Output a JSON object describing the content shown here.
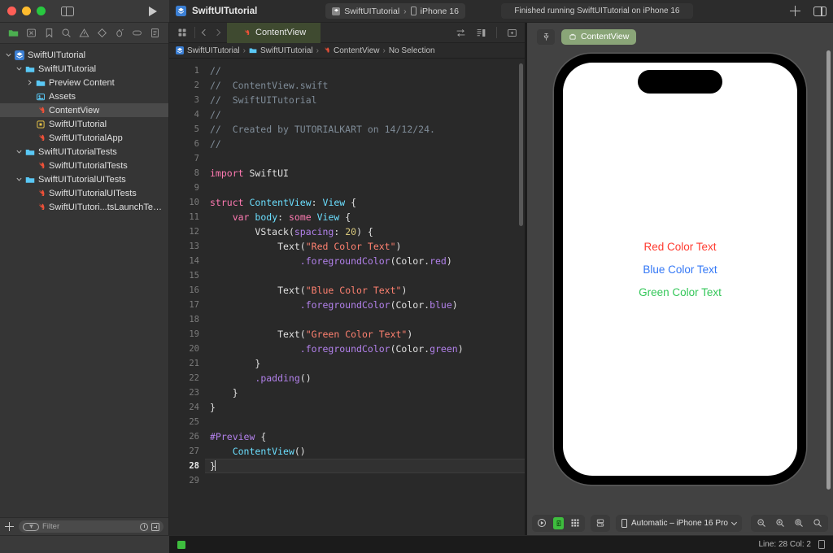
{
  "toolbar": {
    "project_title": "SwiftUITutorial",
    "scheme_name": "SwiftUITutorial",
    "scheme_separator": "›",
    "destination": "iPhone 16",
    "status_message": "Finished running SwiftUITutorial on iPhone 16",
    "add_label": "+",
    "traffic_lights": [
      "close",
      "minimize",
      "zoom"
    ]
  },
  "navigator": {
    "tabs": [
      "folder-icon",
      "x-square-icon",
      "bookmark-icon",
      "search-icon",
      "warning-icon",
      "diamond-icon",
      "debug-icon",
      "capsule-icon",
      "report-icon"
    ],
    "filter": {
      "placeholder": "Filter"
    },
    "tree": [
      {
        "label": "SwiftUITutorial",
        "indent": 0,
        "twisty": "down",
        "icon": "xcode-project-icon",
        "selected": false
      },
      {
        "label": "SwiftUITutorial",
        "indent": 1,
        "twisty": "down",
        "icon": "folder-icon",
        "selected": false
      },
      {
        "label": "Preview Content",
        "indent": 2,
        "twisty": "right",
        "icon": "folder-icon",
        "selected": false
      },
      {
        "label": "Assets",
        "indent": 2,
        "twisty": "none",
        "icon": "assets-icon",
        "selected": false
      },
      {
        "label": "ContentView",
        "indent": 2,
        "twisty": "none",
        "icon": "swift-file-icon",
        "selected": true
      },
      {
        "label": "SwiftUITutorial",
        "indent": 2,
        "twisty": "none",
        "icon": "plist-icon",
        "selected": false
      },
      {
        "label": "SwiftUITutorialApp",
        "indent": 2,
        "twisty": "none",
        "icon": "swift-file-icon",
        "selected": false
      },
      {
        "label": "SwiftUITutorialTests",
        "indent": 1,
        "twisty": "down",
        "icon": "folder-icon",
        "selected": false
      },
      {
        "label": "SwiftUITutorialTests",
        "indent": 2,
        "twisty": "none",
        "icon": "swift-file-icon",
        "selected": false
      },
      {
        "label": "SwiftUITutorialUITests",
        "indent": 1,
        "twisty": "down",
        "icon": "folder-icon",
        "selected": false
      },
      {
        "label": "SwiftUITutorialUITests",
        "indent": 2,
        "twisty": "none",
        "icon": "swift-file-icon",
        "selected": false
      },
      {
        "label": "SwiftUITutori...tsLaunchTests",
        "indent": 2,
        "twisty": "none",
        "icon": "swift-file-icon",
        "selected": false
      }
    ]
  },
  "editor": {
    "tab_label": "ContentView",
    "breadcrumb": [
      {
        "label": "SwiftUITutorial",
        "icon": "xcode-project-icon"
      },
      {
        "label": "SwiftUITutorial",
        "icon": "folder-icon"
      },
      {
        "label": "ContentView",
        "icon": "swift-file-icon"
      },
      {
        "label": "No Selection",
        "icon": "none"
      }
    ],
    "breadcrumb_separator": "›",
    "current_line": 28,
    "lines": [
      {
        "n": 1,
        "tokens": [
          {
            "t": "//",
            "c": "cm"
          }
        ]
      },
      {
        "n": 2,
        "tokens": [
          {
            "t": "//  ContentView.swift",
            "c": "cm"
          }
        ]
      },
      {
        "n": 3,
        "tokens": [
          {
            "t": "//  SwiftUITutorial",
            "c": "cm"
          }
        ]
      },
      {
        "n": 4,
        "tokens": [
          {
            "t": "//",
            "c": "cm"
          }
        ]
      },
      {
        "n": 5,
        "tokens": [
          {
            "t": "//  Created by TUTORIALKART on 14/12/24.",
            "c": "cm"
          }
        ]
      },
      {
        "n": 6,
        "tokens": [
          {
            "t": "//",
            "c": "cm"
          }
        ]
      },
      {
        "n": 7,
        "tokens": []
      },
      {
        "n": 8,
        "tokens": [
          {
            "t": "import",
            "c": "kw"
          },
          {
            "t": " SwiftUI",
            "c": ""
          }
        ]
      },
      {
        "n": 9,
        "tokens": []
      },
      {
        "n": 10,
        "tokens": [
          {
            "t": "struct",
            "c": "kw"
          },
          {
            "t": " ",
            "c": ""
          },
          {
            "t": "ContentView",
            "c": "ty"
          },
          {
            "t": ": ",
            "c": ""
          },
          {
            "t": "View",
            "c": "ty"
          },
          {
            "t": " {",
            "c": ""
          }
        ]
      },
      {
        "n": 11,
        "tokens": [
          {
            "t": "    ",
            "c": ""
          },
          {
            "t": "var",
            "c": "kw"
          },
          {
            "t": " ",
            "c": ""
          },
          {
            "t": "body",
            "c": "ty"
          },
          {
            "t": ": ",
            "c": ""
          },
          {
            "t": "some",
            "c": "kw"
          },
          {
            "t": " ",
            "c": ""
          },
          {
            "t": "View",
            "c": "ty"
          },
          {
            "t": " {",
            "c": ""
          }
        ]
      },
      {
        "n": 12,
        "tokens": [
          {
            "t": "        ",
            "c": ""
          },
          {
            "t": "VStack",
            "c": ""
          },
          {
            "t": "(",
            "c": ""
          },
          {
            "t": "spacing",
            "c": "fn"
          },
          {
            "t": ": ",
            "c": ""
          },
          {
            "t": "20",
            "c": "num"
          },
          {
            "t": ") {",
            "c": ""
          }
        ]
      },
      {
        "n": 13,
        "tokens": [
          {
            "t": "            ",
            "c": ""
          },
          {
            "t": "Text",
            "c": ""
          },
          {
            "t": "(",
            "c": ""
          },
          {
            "t": "\"Red Color Text\"",
            "c": "st"
          },
          {
            "t": ")",
            "c": ""
          }
        ]
      },
      {
        "n": 14,
        "tokens": [
          {
            "t": "                ",
            "c": ""
          },
          {
            "t": ".foregroundColor",
            "c": "fn"
          },
          {
            "t": "(",
            "c": ""
          },
          {
            "t": "Color",
            "c": ""
          },
          {
            "t": ".",
            "c": ""
          },
          {
            "t": "red",
            "c": "fn"
          },
          {
            "t": ")",
            "c": ""
          }
        ]
      },
      {
        "n": 15,
        "tokens": []
      },
      {
        "n": 16,
        "tokens": [
          {
            "t": "            ",
            "c": ""
          },
          {
            "t": "Text",
            "c": ""
          },
          {
            "t": "(",
            "c": ""
          },
          {
            "t": "\"Blue Color Text\"",
            "c": "st"
          },
          {
            "t": ")",
            "c": ""
          }
        ]
      },
      {
        "n": 17,
        "tokens": [
          {
            "t": "                ",
            "c": ""
          },
          {
            "t": ".foregroundColor",
            "c": "fn"
          },
          {
            "t": "(",
            "c": ""
          },
          {
            "t": "Color",
            "c": ""
          },
          {
            "t": ".",
            "c": ""
          },
          {
            "t": "blue",
            "c": "fn"
          },
          {
            "t": ")",
            "c": ""
          }
        ]
      },
      {
        "n": 18,
        "tokens": []
      },
      {
        "n": 19,
        "tokens": [
          {
            "t": "            ",
            "c": ""
          },
          {
            "t": "Text",
            "c": ""
          },
          {
            "t": "(",
            "c": ""
          },
          {
            "t": "\"Green Color Text\"",
            "c": "st"
          },
          {
            "t": ")",
            "c": ""
          }
        ]
      },
      {
        "n": 20,
        "tokens": [
          {
            "t": "                ",
            "c": ""
          },
          {
            "t": ".foregroundColor",
            "c": "fn"
          },
          {
            "t": "(",
            "c": ""
          },
          {
            "t": "Color",
            "c": ""
          },
          {
            "t": ".",
            "c": ""
          },
          {
            "t": "green",
            "c": "fn"
          },
          {
            "t": ")",
            "c": ""
          }
        ]
      },
      {
        "n": 21,
        "tokens": [
          {
            "t": "        }",
            "c": ""
          }
        ]
      },
      {
        "n": 22,
        "tokens": [
          {
            "t": "        ",
            "c": ""
          },
          {
            "t": ".padding",
            "c": "fn"
          },
          {
            "t": "()",
            "c": ""
          }
        ]
      },
      {
        "n": 23,
        "tokens": [
          {
            "t": "    }",
            "c": ""
          }
        ]
      },
      {
        "n": 24,
        "tokens": [
          {
            "t": "}",
            "c": ""
          }
        ]
      },
      {
        "n": 25,
        "tokens": []
      },
      {
        "n": 26,
        "tokens": [
          {
            "t": "#Preview",
            "c": "pp"
          },
          {
            "t": " {",
            "c": ""
          }
        ]
      },
      {
        "n": 27,
        "tokens": [
          {
            "t": "    ",
            "c": ""
          },
          {
            "t": "ContentView",
            "c": "ty"
          },
          {
            "t": "()",
            "c": ""
          }
        ]
      },
      {
        "n": 28,
        "tokens": [
          {
            "t": "}",
            "c": ""
          }
        ]
      },
      {
        "n": 29,
        "tokens": []
      }
    ]
  },
  "canvas": {
    "preview_pill_label": "ContentView",
    "device_selector": "Automatic – iPhone 16 Pro",
    "preview_texts": [
      {
        "label": "Red Color Text",
        "color": "#ff3b30"
      },
      {
        "label": "Blue Color Text",
        "color": "#3478f6"
      },
      {
        "label": "Green Color Text",
        "color": "#34c759"
      }
    ]
  },
  "statusbar": {
    "line_col": "Line: 28  Col: 2"
  },
  "colors": {
    "accent_tab": "#3f4a30",
    "preview_pill": "#8aa578",
    "build_success": "#3ebd3e",
    "keyword": "#ff7ab2",
    "type": "#6bdfff",
    "string": "#ff8170",
    "function": "#b281eb",
    "comment": "#7f8c98",
    "number": "#d9c97c"
  }
}
